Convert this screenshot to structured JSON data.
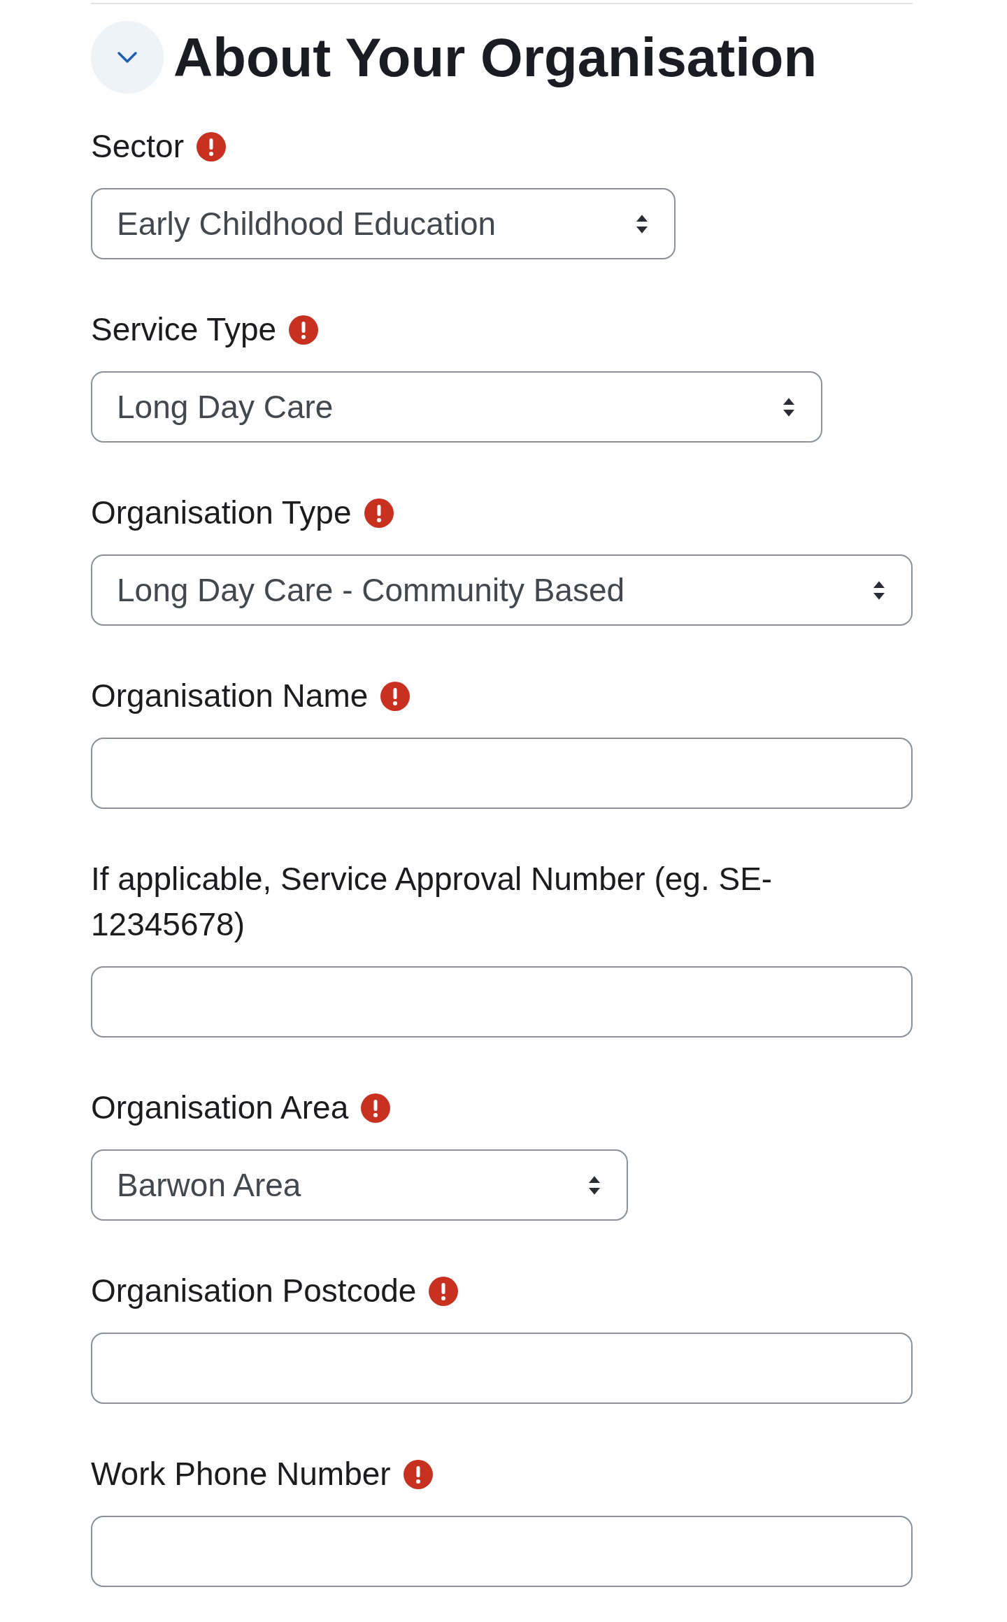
{
  "section": {
    "title": "About Your Organisation",
    "expanded": true
  },
  "fields": [
    {
      "kind": "select",
      "label": "Sector",
      "required": true,
      "value": "Early Childhood Education"
    },
    {
      "kind": "select",
      "label": "Service Type",
      "required": true,
      "value": "Long Day Care"
    },
    {
      "kind": "select",
      "label": "Organisation Type",
      "required": true,
      "value": "Long Day Care - Community Based"
    },
    {
      "kind": "text",
      "label": "Organisation Name",
      "required": true
    },
    {
      "kind": "text",
      "label": "If applicable, Service Approval Number (eg. SE-12345678)",
      "required": false
    },
    {
      "kind": "select",
      "label": "Organisation Area",
      "required": true,
      "value": "Barwon Area"
    },
    {
      "kind": "text",
      "label": "Organisation Postcode",
      "required": true
    },
    {
      "kind": "text",
      "label": "Work Phone Number",
      "required": true
    }
  ]
}
